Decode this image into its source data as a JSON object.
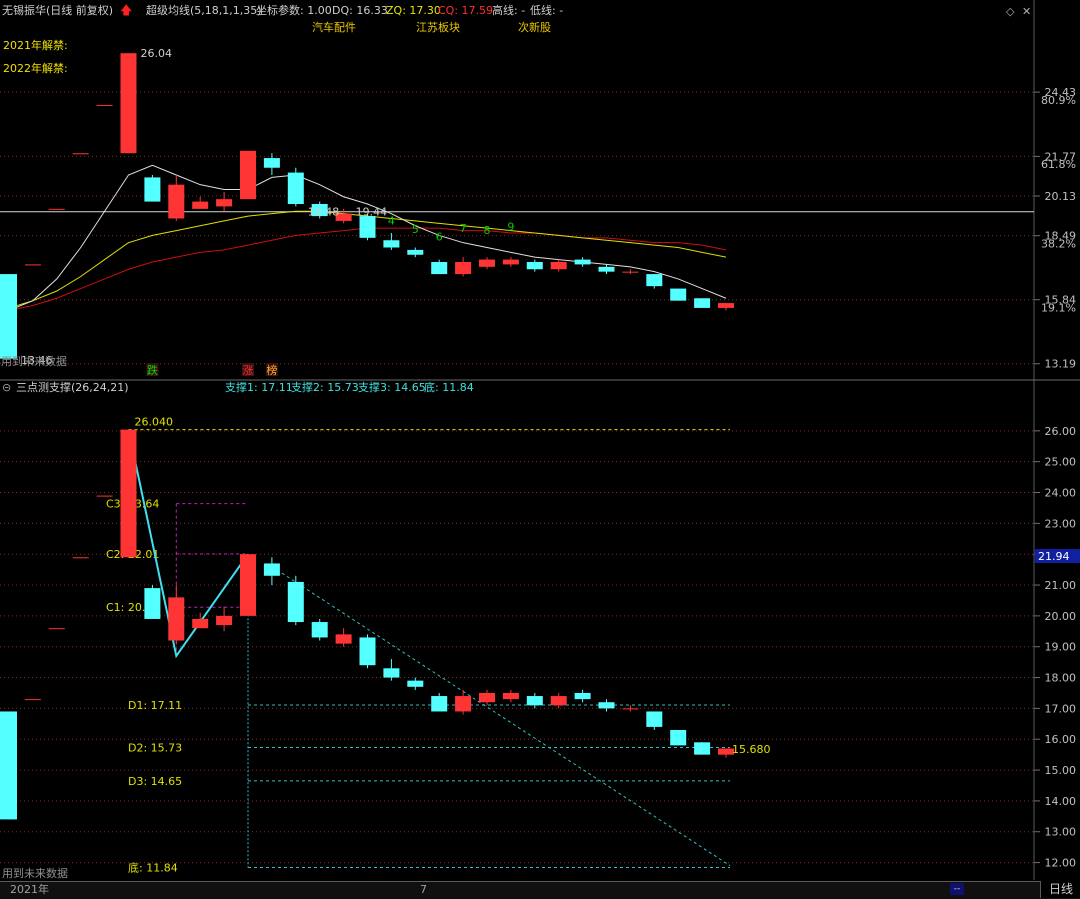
{
  "title_bar": {
    "stock_name": "无锡振华(日线 前复权)",
    "indicator": "超级均线(5,18,1,1,35)",
    "coord_label": "坐标参数: 1.00",
    "dq_label": "DQ: 16.33",
    "zq_label": "ZQ: 17.30",
    "cq_label": "CQ: 17.59",
    "high_line": "高线: -",
    "low_line": "低线: -"
  },
  "concept_tags": [
    "汽车配件",
    "江苏板块",
    "次新股"
  ],
  "unlock_labels": [
    "2021年解禁:",
    "2022年解禁:"
  ],
  "main_chart": {
    "price_axis": {
      "min": 12.6,
      "max": 27.0
    },
    "ticks": [
      {
        "label": "24.43",
        "value": 24.43
      },
      {
        "label": "21.77",
        "value": 21.77
      },
      {
        "label": "20.13",
        "value": 20.13
      },
      {
        "label": "18.49",
        "value": 18.49
      },
      {
        "label": "15.84",
        "value": 15.84
      },
      {
        "label": "13.19",
        "value": 13.19
      }
    ],
    "pct_ticks": [
      {
        "label": "80.9%",
        "value": 24.1
      },
      {
        "label": "61.8%",
        "value": 21.45
      },
      {
        "label": "38.2%",
        "value": 18.17
      },
      {
        "label": "19.1%",
        "value": 15.52
      }
    ],
    "candles": [
      {
        "o": 16.9,
        "c": 13.4,
        "h": 16.9,
        "l": 13.4
      },
      {
        "o": 17.3,
        "c": 17.3,
        "h": 17.3,
        "l": 17.3
      },
      {
        "o": 19.6,
        "c": 19.6,
        "h": 19.6,
        "l": 19.6
      },
      {
        "o": 21.9,
        "c": 21.9,
        "h": 21.9,
        "l": 21.9
      },
      {
        "o": 23.9,
        "c": 23.9,
        "h": 23.9,
        "l": 23.9
      },
      {
        "o": 21.9,
        "c": 26.04,
        "h": 26.04,
        "l": 21.9
      },
      {
        "o": 20.9,
        "c": 19.9,
        "h": 21.0,
        "l": 19.9
      },
      {
        "o": 19.2,
        "c": 20.6,
        "h": 21.0,
        "l": 19.1
      },
      {
        "o": 19.6,
        "c": 19.9,
        "h": 20.1,
        "l": 19.6
      },
      {
        "o": 19.7,
        "c": 20.0,
        "h": 20.3,
        "l": 19.5
      },
      {
        "o": 20.0,
        "c": 22.0,
        "h": 22.0,
        "l": 20.0
      },
      {
        "o": 21.7,
        "c": 21.3,
        "h": 21.9,
        "l": 21.0
      },
      {
        "o": 21.1,
        "c": 19.8,
        "h": 21.3,
        "l": 19.7
      },
      {
        "o": 19.8,
        "c": 19.3,
        "h": 19.9,
        "l": 19.2
      },
      {
        "o": 19.1,
        "c": 19.4,
        "h": 19.6,
        "l": 19.0
      },
      {
        "o": 19.3,
        "c": 18.4,
        "h": 19.4,
        "l": 18.3
      },
      {
        "o": 18.3,
        "c": 18.0,
        "h": 18.6,
        "l": 17.9
      },
      {
        "o": 17.9,
        "c": 17.7,
        "h": 18.0,
        "l": 17.6
      },
      {
        "o": 17.4,
        "c": 16.9,
        "h": 17.5,
        "l": 16.9
      },
      {
        "o": 16.9,
        "c": 17.4,
        "h": 17.6,
        "l": 16.8
      },
      {
        "o": 17.2,
        "c": 17.5,
        "h": 17.6,
        "l": 17.1
      },
      {
        "o": 17.3,
        "c": 17.5,
        "h": 17.6,
        "l": 17.2
      },
      {
        "o": 17.4,
        "c": 17.1,
        "h": 17.5,
        "l": 17.0
      },
      {
        "o": 17.1,
        "c": 17.4,
        "h": 17.5,
        "l": 17.0
      },
      {
        "o": 17.5,
        "c": 17.3,
        "h": 17.6,
        "l": 17.2
      },
      {
        "o": 17.2,
        "c": 17.0,
        "h": 17.3,
        "l": 16.9
      },
      {
        "o": 17.0,
        "c": 17.0,
        "h": 17.1,
        "l": 16.9
      },
      {
        "o": 16.9,
        "c": 16.4,
        "h": 16.9,
        "l": 16.3
      },
      {
        "o": 16.3,
        "c": 15.8,
        "h": 16.3,
        "l": 15.8
      },
      {
        "o": 15.9,
        "c": 15.5,
        "h": 15.9,
        "l": 15.5
      },
      {
        "o": 15.5,
        "c": 15.7,
        "h": 15.7,
        "l": 15.4
      }
    ],
    "ma_white": [
      15.4,
      15.8,
      16.7,
      18.0,
      19.5,
      21.0,
      21.4,
      21.0,
      20.6,
      20.4,
      20.4,
      20.9,
      21.0,
      20.6,
      20.1,
      19.8,
      19.4,
      18.9,
      18.5,
      18.2,
      18.0,
      17.8,
      17.6,
      17.5,
      17.4,
      17.3,
      17.2,
      17.0,
      16.7,
      16.3,
      15.9
    ],
    "ma_yellow": [
      15.5,
      15.8,
      16.2,
      16.8,
      17.5,
      18.2,
      18.5,
      18.7,
      18.9,
      19.1,
      19.3,
      19.4,
      19.5,
      19.5,
      19.4,
      19.3,
      19.2,
      19.1,
      19.0,
      18.9,
      18.8,
      18.7,
      18.6,
      18.5,
      18.4,
      18.3,
      18.2,
      18.1,
      18.0,
      17.8,
      17.6
    ],
    "ma_red": [
      15.4,
      15.6,
      15.9,
      16.3,
      16.7,
      17.1,
      17.4,
      17.6,
      17.8,
      17.9,
      18.1,
      18.3,
      18.5,
      18.6,
      18.7,
      18.8,
      18.8,
      18.8,
      18.8,
      18.7,
      18.7,
      18.6,
      18.6,
      18.5,
      18.4,
      18.4,
      18.3,
      18.2,
      18.2,
      18.1,
      17.9
    ],
    "hline": 19.48,
    "annotations": [
      {
        "text": "26.04",
        "i": 5,
        "price": 26.04,
        "color": "#d0d0d0"
      },
      {
        "text": "19.48",
        "i": 12,
        "price": 19.48,
        "color": "#d0d0d0"
      },
      {
        "text": "19.44",
        "i": 14,
        "price": 19.48,
        "color": "#d0d0d0"
      },
      {
        "text": "13.46",
        "i": 0,
        "price": 13.35,
        "color": "#d0d0d0"
      }
    ],
    "td_counts": [
      {
        "text": "4",
        "i": 16,
        "price": 18.95
      },
      {
        "text": "5",
        "i": 17,
        "price": 18.6
      },
      {
        "text": "6",
        "i": 18,
        "price": 18.3
      },
      {
        "text": "7",
        "i": 19,
        "price": 18.65
      },
      {
        "text": "8",
        "i": 20,
        "price": 18.55
      },
      {
        "text": "9",
        "i": 21,
        "price": 18.7
      }
    ],
    "bottom_marks": [
      {
        "text": "跌",
        "i": 6,
        "color": "#00e000"
      },
      {
        "text": "涨",
        "i": 10,
        "color": "#ff3030"
      },
      {
        "text": "榜",
        "i": 11,
        "color": "#ffb020"
      }
    ],
    "future_data_label": "用到未来数据"
  },
  "sub_chart": {
    "title": "三点测支撑(26,24,21)",
    "values_text": [
      "支撑1: 17.11",
      "支撑2: 15.73",
      "支撑3: 14.65",
      "底: 11.84"
    ],
    "price_axis": {
      "min": 11.5,
      "max": 27.0
    },
    "ticks": [
      26.0,
      25.0,
      24.0,
      23.0,
      22.0,
      21.0,
      20.0,
      19.0,
      18.0,
      17.0,
      16.0,
      15.0,
      14.0,
      13.0,
      12.0
    ],
    "current_price_tag": "21.94",
    "current_price": 21.94,
    "high_label": "26.040",
    "low_label": "15.680",
    "c_levels": [
      {
        "label": "C3: 23.64",
        "value": 23.64
      },
      {
        "label": "C2: 22.01",
        "value": 22.01
      },
      {
        "label": "C1: 20.28",
        "value": 20.28
      }
    ],
    "d_levels": [
      {
        "label": "D1: 17.11",
        "value": 17.11
      },
      {
        "label": "D2: 15.73",
        "value": 15.73
      },
      {
        "label": "D3: 14.65",
        "value": 14.65
      },
      {
        "label": "底: 11.84",
        "value": 11.84
      }
    ],
    "zigzag": [
      {
        "i": 5,
        "price": 26.04
      },
      {
        "i": 7,
        "price": 18.7
      },
      {
        "i": 10,
        "price": 22.0
      }
    ],
    "future_data_label": "用到未来数据"
  },
  "axis_bar": {
    "year_label": "2021年",
    "month_label": "7",
    "mini_label": "--",
    "period": "日线"
  },
  "colors": {
    "up": "#ff3535",
    "down": "#54ffff",
    "ma_white": "#e0e0e0",
    "ma_yellow": "#e0e000",
    "ma_red": "#cc1010",
    "grid": "#8a2a2a",
    "hline": "#d8d8d8"
  }
}
